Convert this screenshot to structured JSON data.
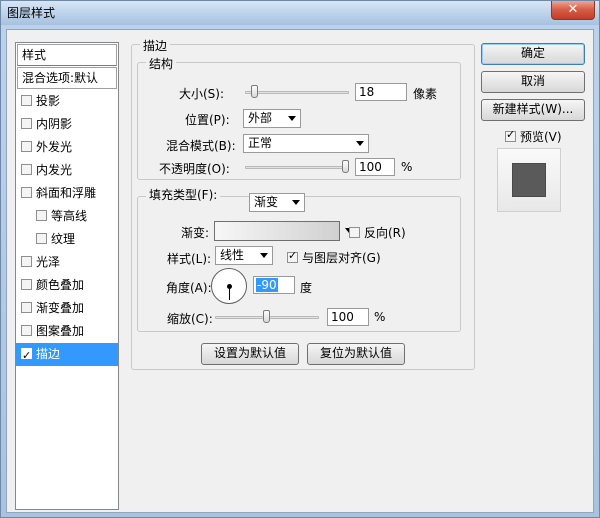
{
  "window": {
    "title": "图层样式",
    "close_label": "✕"
  },
  "style_list": {
    "header": "样式",
    "blend_options": "混合选项:默认",
    "items": [
      {
        "label": "投影",
        "checked": false,
        "sub": false,
        "selected": false
      },
      {
        "label": "内阴影",
        "checked": false,
        "sub": false,
        "selected": false
      },
      {
        "label": "外发光",
        "checked": false,
        "sub": false,
        "selected": false
      },
      {
        "label": "内发光",
        "checked": false,
        "sub": false,
        "selected": false
      },
      {
        "label": "斜面和浮雕",
        "checked": false,
        "sub": false,
        "selected": false
      },
      {
        "label": "等高线",
        "checked": false,
        "sub": true,
        "selected": false
      },
      {
        "label": "纹理",
        "checked": false,
        "sub": true,
        "selected": false
      },
      {
        "label": "光泽",
        "checked": false,
        "sub": false,
        "selected": false
      },
      {
        "label": "颜色叠加",
        "checked": false,
        "sub": false,
        "selected": false
      },
      {
        "label": "渐变叠加",
        "checked": false,
        "sub": false,
        "selected": false
      },
      {
        "label": "图案叠加",
        "checked": false,
        "sub": false,
        "selected": false
      },
      {
        "label": "描边",
        "checked": true,
        "sub": false,
        "selected": true
      }
    ]
  },
  "stroke": {
    "title": "描边",
    "structure": {
      "title": "结构",
      "size_label": "大小(S):",
      "size_value": "18",
      "size_unit": "像素",
      "size_fraction": 0.07,
      "position_label": "位置(P):",
      "position_value": "外部",
      "blend_label": "混合模式(B):",
      "blend_value": "正常",
      "opacity_label": "不透明度(O):",
      "opacity_value": "100",
      "opacity_unit": "%",
      "opacity_fraction": 1.0
    },
    "fill": {
      "type_label": "填充类型(F):",
      "type_value": "渐变",
      "gradient_label": "渐变:",
      "reverse_label": "反向(R)",
      "reverse_checked": false,
      "style_label": "样式(L):",
      "style_value": "线性",
      "align_label": "与图层对齐(G)",
      "align_checked": true,
      "angle_label": "角度(A):",
      "angle_value": "-90",
      "angle_unit": "度",
      "scale_label": "缩放(C):",
      "scale_value": "100",
      "scale_unit": "%",
      "scale_fraction": 0.5
    },
    "set_default": "设置为默认值",
    "reset_default": "复位为默认值"
  },
  "buttons": {
    "ok": "确定",
    "cancel": "取消",
    "new_style": "新建样式(W)...",
    "preview_label": "预览(V)",
    "preview_checked": true
  }
}
